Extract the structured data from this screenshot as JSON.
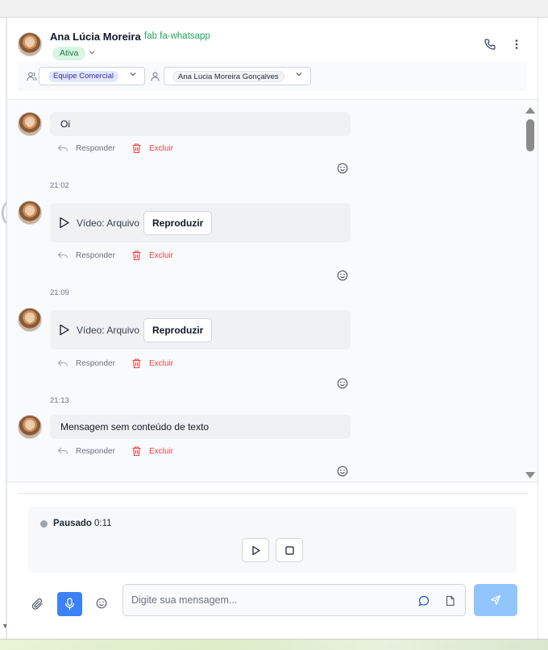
{
  "header": {
    "contact_name": "Ana Lúcia Moreira",
    "channel_tag": "fab fa-whatsapp",
    "status": "Ativa",
    "team": "Equipe Comercial",
    "assignee": "Ana Lucia Moreira Gonçalves"
  },
  "messages": [
    {
      "text": "Oi",
      "reply_label": "Responder",
      "delete_label": "Excluir"
    },
    {
      "time": "21:02",
      "video_label": "Vídeo: Arquivo",
      "play_label": "Reproduzir",
      "reply_label": "Responder",
      "delete_label": "Excluir"
    },
    {
      "time": "21:09",
      "video_label": "Vídeo: Arquivo",
      "play_label": "Reproduzir",
      "reply_label": "Responder",
      "delete_label": "Excluir"
    },
    {
      "time": "21:13",
      "text": "Mensagem sem conteúdo de texto",
      "reply_label": "Responder",
      "delete_label": "Excluir"
    }
  ],
  "recorder": {
    "status": "Pausado",
    "time": "0:11"
  },
  "composer": {
    "placeholder": "Digite sua mensagem..."
  },
  "colors": {
    "accent": "#3b82f6",
    "send_button": "#93c5fd",
    "status_green": "#15803d",
    "delete_red": "#ef4444"
  },
  "icons": [
    "phone-icon",
    "kebab-menu-icon",
    "team-icon",
    "user-icon",
    "reply-icon",
    "trash-icon",
    "smile-icon",
    "play-icon",
    "stop-icon",
    "paperclip-icon",
    "microphone-icon",
    "chat-icon",
    "file-icon",
    "send-icon"
  ]
}
